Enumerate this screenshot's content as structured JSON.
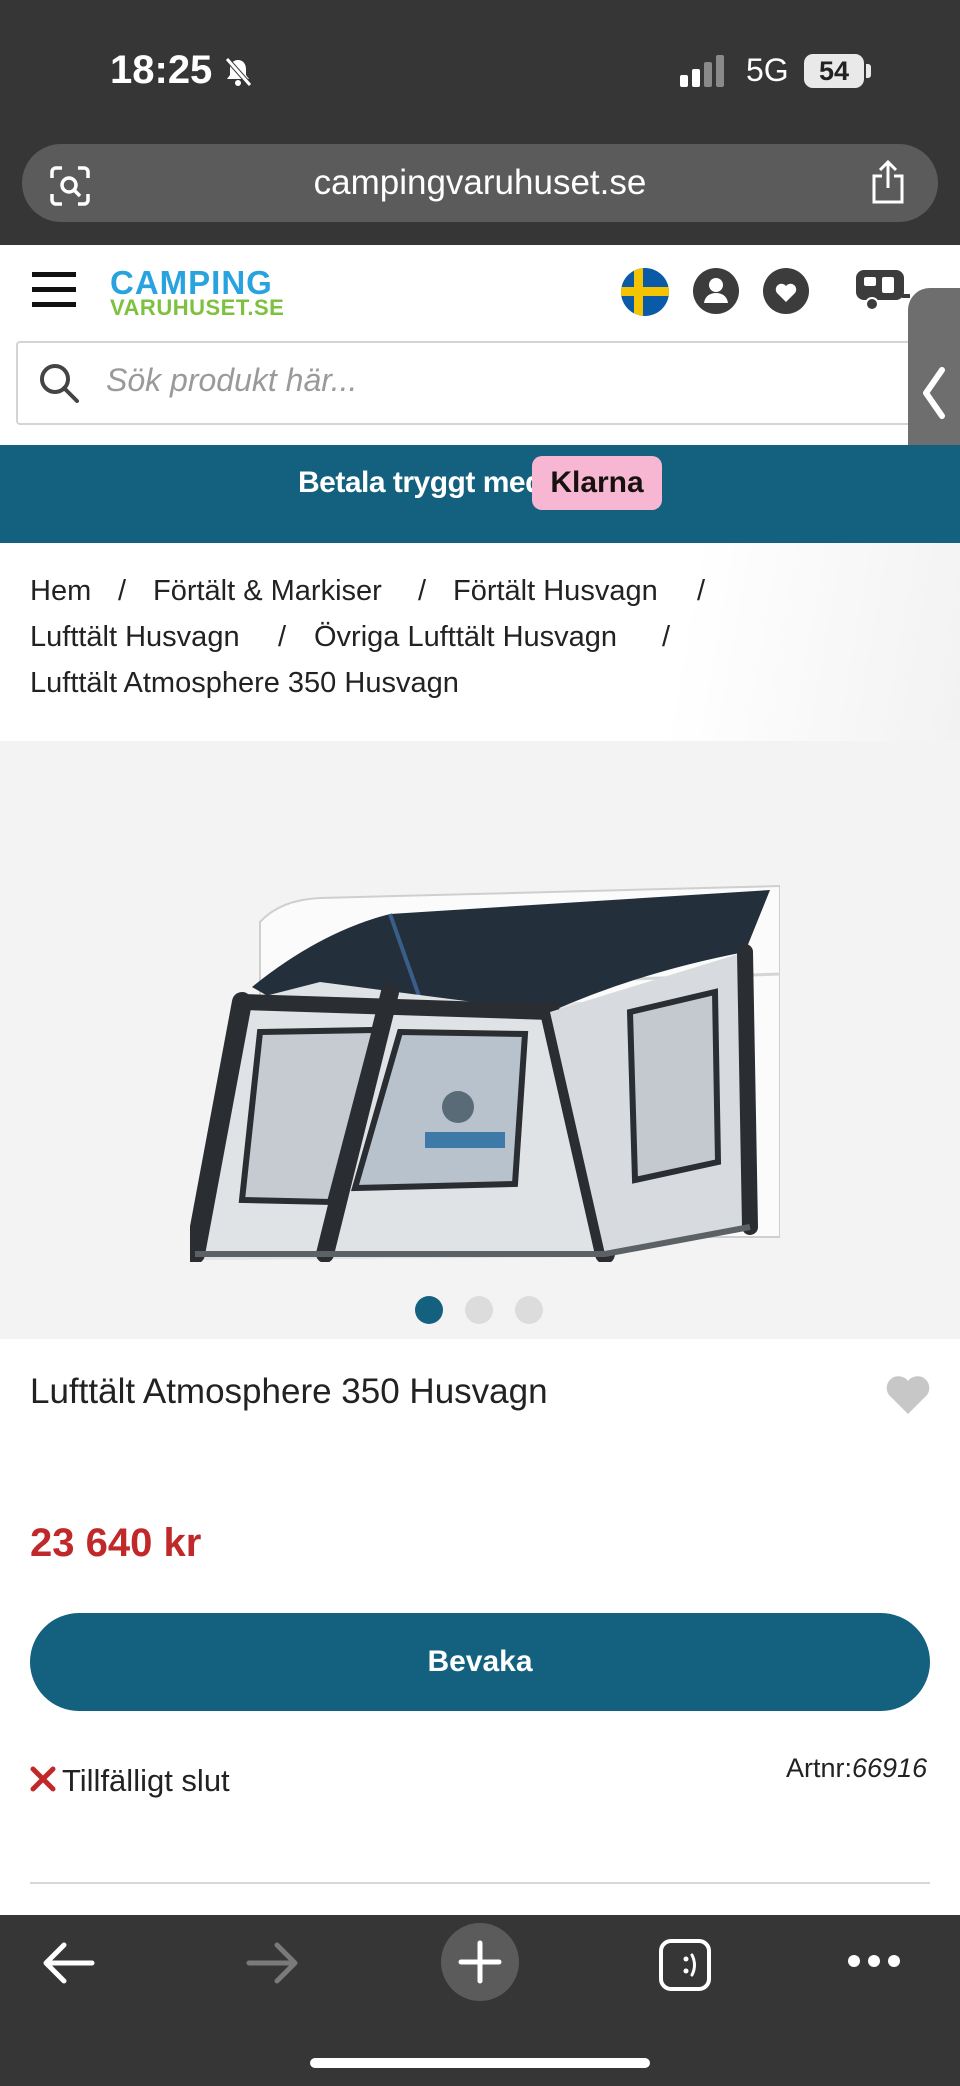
{
  "status_bar": {
    "time": "18:25",
    "network": "5G",
    "battery": "54"
  },
  "browser": {
    "url": "campingvaruhuset.se"
  },
  "header": {
    "logo_top": "CAMPING",
    "logo_bottom": "VARUHUSET.SE",
    "search_placeholder": "Sök produkt här..."
  },
  "banner": {
    "text": "Betala tryggt med",
    "badge": "Klarna"
  },
  "breadcrumb": {
    "items": [
      "Hem",
      "Förtält & Markiser",
      "Förtält Husvagn",
      "Lufttält Husvagn",
      "Övriga Lufttält Husvagn",
      "Lufttält Atmosphere 350 Husvagn"
    ],
    "separator": "/"
  },
  "gallery": {
    "slides": 3,
    "active": 1
  },
  "product": {
    "title": "Lufttält Atmosphere 350 Husvagn",
    "price": "23 640 kr",
    "watch_label": "Bevaka",
    "stock": "Tillfälligt slut",
    "artnr_label": "Artnr:",
    "artnr_value": "66916"
  },
  "colors": {
    "brand": "#13617f",
    "price": "#c0282a",
    "klarna": "#f7b6d1",
    "logo_blue": "#29a3de",
    "logo_green": "#7ec13f"
  }
}
